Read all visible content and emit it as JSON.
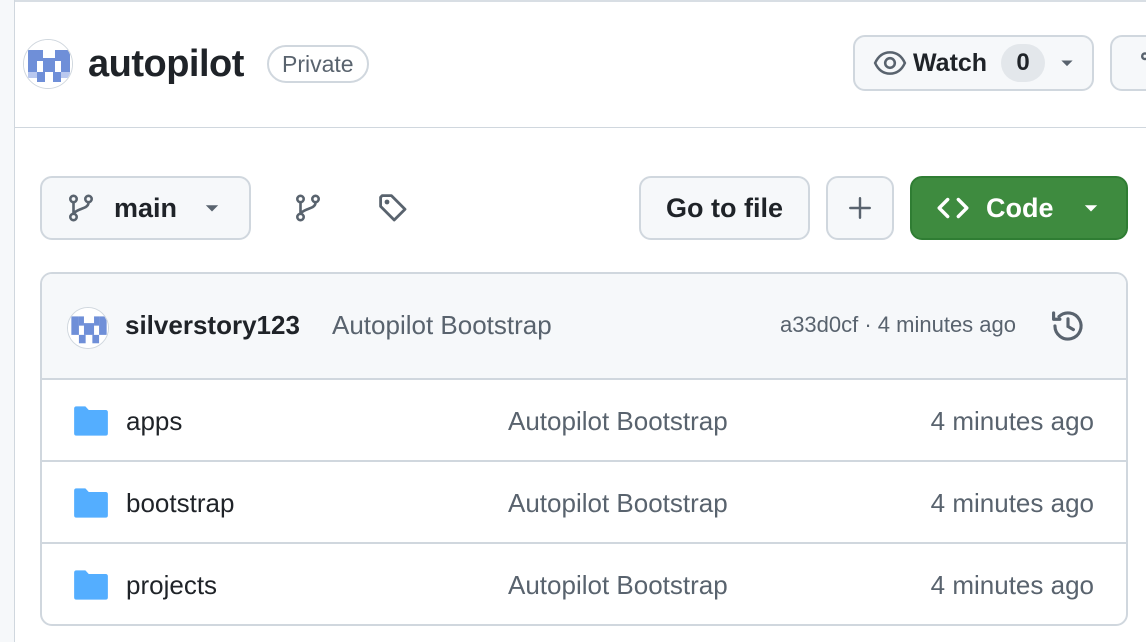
{
  "repo": {
    "name": "autopilot",
    "visibility": "Private"
  },
  "watch": {
    "label": "Watch",
    "count": "0"
  },
  "toolbar": {
    "branch": "main",
    "go_to_file": "Go to file",
    "code": "Code"
  },
  "latest_commit": {
    "author": "silverstory123",
    "message": "Autopilot Bootstrap",
    "meta": "a33d0cf · 4 minutes ago"
  },
  "files": [
    {
      "name": "apps",
      "commit": "Autopilot Bootstrap",
      "age": "4 minutes ago"
    },
    {
      "name": "bootstrap",
      "commit": "Autopilot Bootstrap",
      "age": "4 minutes ago"
    },
    {
      "name": "projects",
      "commit": "Autopilot Bootstrap",
      "age": "4 minutes ago"
    }
  ],
  "colors": {
    "code_button": "#3e8b3f",
    "folder": "#54aeff",
    "border": "#d0d7de",
    "muted_text": "#59636e"
  },
  "icons": {
    "repo_avatar": "identicon-avatar",
    "watch": "eye-icon",
    "branch": "git-branch-icon",
    "tags": "tag-icon",
    "add": "plus-icon",
    "code": "code-icon",
    "history": "history-icon",
    "folder": "folder-icon"
  }
}
